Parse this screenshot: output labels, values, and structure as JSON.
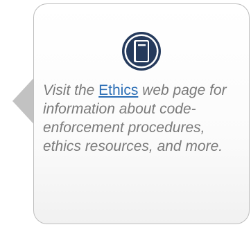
{
  "callout": {
    "text_before": "Visit the ",
    "link_label": "Ethics",
    "text_after": " web page for information about code-enforcement procedures, ethics resources, and more.",
    "icon": "book-icon"
  },
  "colors": {
    "icon_navy": "#253a5c",
    "link_blue": "#2a6db5",
    "text_gray": "#7a7a7a",
    "border_gray": "#bdbdbd",
    "pointer_gray": "#c2c2c2"
  }
}
